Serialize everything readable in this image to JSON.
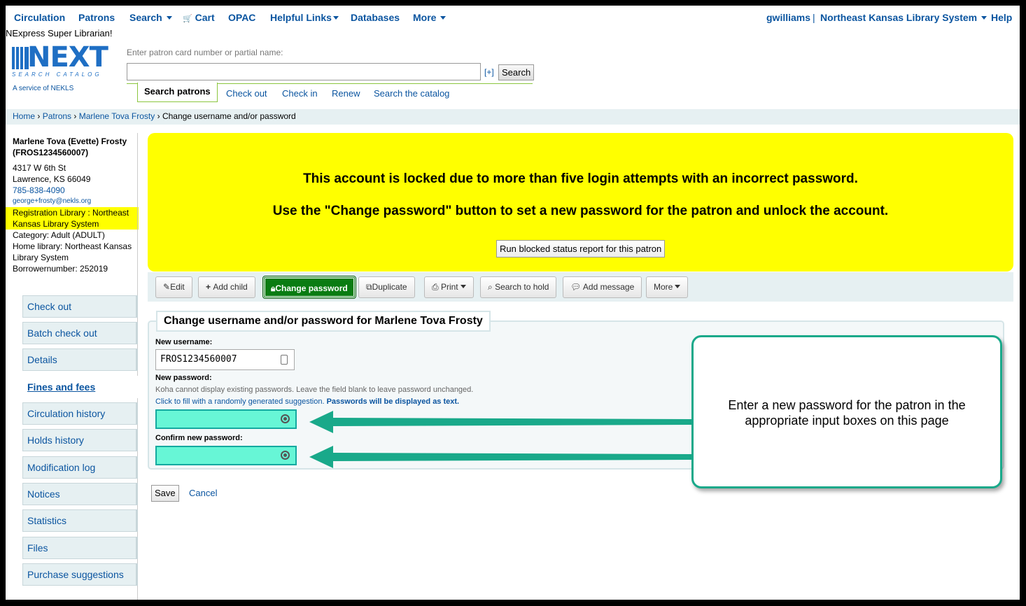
{
  "topnav": {
    "circulation": "Circulation",
    "patrons": "Patrons",
    "search": "Search",
    "cart": "Cart",
    "opac": "OPAC",
    "helpful_links": "Helpful Links",
    "databases": "Databases",
    "more": "More",
    "user": "gwilliams",
    "separator": "|",
    "library": "Northeast Kansas Library System",
    "help": "Help"
  },
  "greeting": "NExpress Super Librarian!",
  "logo": {
    "main": "NEXT",
    "sub": "SEARCH CATALOG",
    "service": "A service of NEKLS"
  },
  "patron_search": {
    "label": "Enter patron card number or partial name:",
    "value": "",
    "plus": "[+]",
    "button": "Search"
  },
  "tabs": [
    "Search patrons",
    "Check out",
    "Check in",
    "Renew",
    "Search the catalog"
  ],
  "breadcrumb": {
    "home": "Home",
    "patrons": "Patrons",
    "patron": "Marlene Tova Frosty",
    "current": "Change username and/or password",
    "sep": "›"
  },
  "patron": {
    "name": "Marlene Tova (Evette) Frosty",
    "card": "(FROS1234560007)",
    "address1": "4317 W 6th St",
    "address2": "Lawrence, KS 66049",
    "phone": "785-838-4090",
    "email": "george+frosty@nekls.org",
    "registration": "Registration Library : Northeast Kansas Library System",
    "category": "Category: Adult (ADULT)",
    "home_library": "Home library: Northeast Kansas Library System",
    "borrowernumber": "Borrowernumber: 252019"
  },
  "menu": [
    "Check out",
    "Batch check out",
    "Details",
    "Fines and fees",
    "Circulation history",
    "Holds history",
    "Modification log",
    "Notices",
    "Statistics",
    "Files",
    "Purchase suggestions"
  ],
  "alert": {
    "line1": "This account is locked due to more than five login attempts with an incorrect password.",
    "line2": "Use the \"Change password\" button to set a new password for the patron and unlock the account.",
    "button": "Run blocked status report for this patron"
  },
  "toolbar": {
    "edit": "Edit",
    "add_child": "Add child",
    "change_password": "Change password",
    "duplicate": "Duplicate",
    "print": "Print",
    "search_to_hold": "Search to hold",
    "add_message": "Add message",
    "more": "More"
  },
  "form": {
    "legend": "Change username and/or password for Marlene Tova Frosty",
    "username_label": "New username:",
    "username_value": "FROS1234560007",
    "password_label": "New password:",
    "hint1": "Koha cannot display existing passwords. Leave the field blank to leave password unchanged.",
    "hint2_link": "Click to fill with a randomly generated suggestion.",
    "hint2_bold": "Passwords will be displayed as text.",
    "confirm_label": "Confirm new password:",
    "save": "Save",
    "cancel": "Cancel"
  },
  "annotation": {
    "text": "Enter a new password for the patron in the appropriate input boxes on this page",
    "color": "#19a98a"
  },
  "colors": {
    "link": "#0b55a0",
    "alert": "#ffff00",
    "primary": "#0a7c12",
    "highlight": "#67f6d6"
  }
}
